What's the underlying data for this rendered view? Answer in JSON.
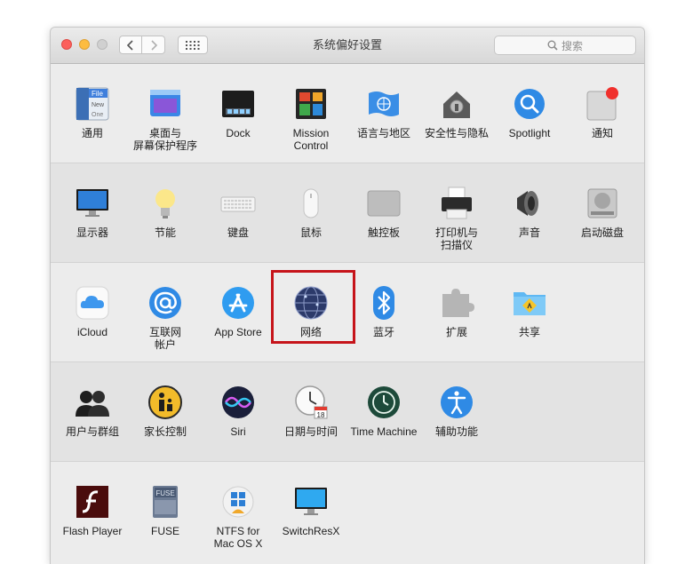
{
  "window": {
    "title": "系统偏好设置",
    "search_placeholder": "搜索"
  },
  "rows": [
    [
      "通用",
      "桌面与\n屏幕保护程序",
      "Dock",
      "Mission\nControl",
      "语言与地区",
      "安全性与隐私",
      "Spotlight",
      "通知"
    ],
    [
      "显示器",
      "节能",
      "键盘",
      "鼠标",
      "触控板",
      "打印机与\n扫描仪",
      "声音",
      "启动磁盘"
    ],
    [
      "iCloud",
      "互联网\n帐户",
      "App Store",
      "网络",
      "蓝牙",
      "扩展",
      "共享"
    ],
    [
      "用户与群组",
      "家长控制",
      "Siri",
      "日期与时间",
      "Time Machine",
      "辅助功能"
    ],
    [
      "Flash Player",
      "FUSE",
      "NTFS for\nMac OS X",
      "SwitchResX"
    ]
  ],
  "icons": {
    "general_file_text": [
      "File",
      "New",
      "One"
    ],
    "calendar_day": "18",
    "fuse_text": "FUSE"
  },
  "highlighted_item": "网络",
  "colors": {
    "highlight_border": "#c6141a",
    "close": "#fc605c",
    "minimize": "#fdbc40"
  }
}
